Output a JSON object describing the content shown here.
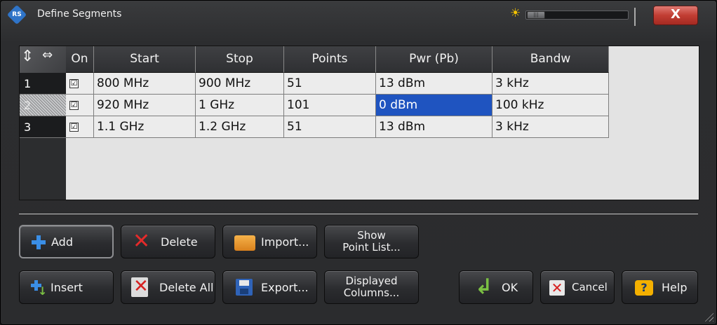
{
  "window": {
    "title": "Define Segments",
    "close_label": "X",
    "logo_text": "RS"
  },
  "table": {
    "columns": [
      "On",
      "Start",
      "Stop",
      "Points",
      "Pwr (Pb)",
      "Bandw"
    ],
    "rows": [
      {
        "index": "1",
        "on": "☑",
        "start": "800 MHz",
        "stop": "900 MHz",
        "points": "51",
        "pwr": "13 dBm",
        "bandw": "3 kHz"
      },
      {
        "index": "2",
        "on": "☑",
        "start": "920 MHz",
        "stop": "1 GHz",
        "points": "101",
        "pwr": "0 dBm",
        "bandw": "100 kHz"
      },
      {
        "index": "3",
        "on": "☑",
        "start": "1.1 GHz",
        "stop": "1.2 GHz",
        "points": "51",
        "pwr": "13 dBm",
        "bandw": "3 kHz"
      }
    ],
    "selected_row": "2",
    "active_cell": "Pwr (Pb)"
  },
  "buttons": {
    "add": "Add",
    "delete": "Delete",
    "import": "Import...",
    "show_point_list_line1": "Show",
    "show_point_list_line2": "Point List...",
    "insert": "Insert",
    "delete_all": "Delete All",
    "export": "Export...",
    "displayed_columns_line1": "Displayed",
    "displayed_columns_line2": "Columns...",
    "ok": "OK",
    "cancel": "Cancel",
    "help": "Help"
  },
  "icons": {
    "brightness": "sun-icon",
    "help": "?"
  },
  "colors": {
    "accent": "#1f54c0",
    "close_red": "#c13d33",
    "background": "#2c2d2f"
  }
}
